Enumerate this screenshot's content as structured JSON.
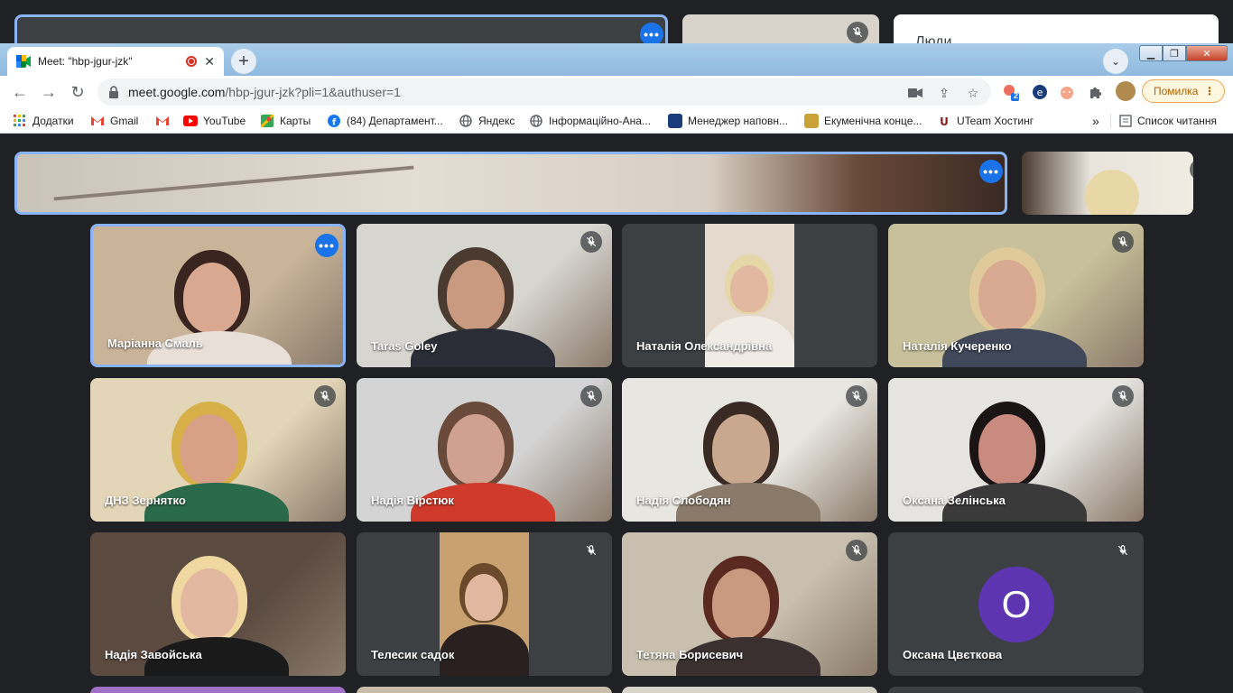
{
  "background_meet": {
    "people_panel_title": "Люди"
  },
  "browser": {
    "tab": {
      "title": "Meet: \"hbp-jgur-jzk\""
    },
    "new_tab_label": "+",
    "url": {
      "host": "meet.google.com",
      "path": "/hbp-jgur-jzk?pli=1&authuser=1"
    },
    "error_button_label": "Помилка",
    "extension_badge": "2",
    "bookmarks": [
      {
        "label": "Додатки",
        "icon": "apps-grid-icon",
        "color": "#ea4335"
      },
      {
        "label": "Gmail",
        "icon": "gmail-icon",
        "color": "#ea4335"
      },
      {
        "label": "",
        "icon": "gmail-icon",
        "color": "#ea4335"
      },
      {
        "label": "YouTube",
        "icon": "youtube-icon",
        "color": "#ff0000"
      },
      {
        "label": "Карты",
        "icon": "maps-icon",
        "color": "#34a853"
      },
      {
        "label": "(84) Департамент...",
        "icon": "facebook-icon",
        "color": "#1877f2"
      },
      {
        "label": "Яндекс",
        "icon": "globe-icon",
        "color": "#5f6368"
      },
      {
        "label": "Інформаційно-Ана...",
        "icon": "globe-icon",
        "color": "#5f6368"
      },
      {
        "label": "Менеджер наповн...",
        "icon": "site-icon",
        "color": "#1a3d7c"
      },
      {
        "label": "Екуменічна конце...",
        "icon": "site-icon",
        "color": "#c9a23a"
      },
      {
        "label": "UTeam Хостинг",
        "icon": "uteam-icon",
        "color": "#8b1a1a"
      }
    ],
    "bookmarks_more": "»",
    "reading_list": "Список читання"
  },
  "participants": [
    {
      "name": "Маріанна Смаль",
      "active": true,
      "muted": false,
      "bg": "#c9b49a",
      "face": "#d9a890",
      "hair": "#3a2420",
      "shirt": "#e8e0d8"
    },
    {
      "name": "Taras Goley",
      "active": false,
      "muted": true,
      "bg": "#d7d5d0",
      "face": "#c99a80",
      "hair": "#4a3a30",
      "shirt": "#2a2d36"
    },
    {
      "name": "Наталія Олександрівна",
      "active": false,
      "muted": false,
      "bg": "#e4d9cc",
      "face": "#e3b8a0",
      "hair": "#e6d7a8",
      "shirt": "#f0ebe4"
    },
    {
      "name": "Наталія Кучеренко",
      "active": false,
      "muted": true,
      "bg": "#c7c09a",
      "face": "#d9aa92",
      "hair": "#e0c99a",
      "shirt": "#40485a"
    },
    {
      "name": "ДНЗ Зернятко",
      "active": false,
      "muted": true,
      "bg": "#e3d6b8",
      "face": "#d9a088",
      "hair": "#d8b04a",
      "shirt": "#2a6a4a"
    },
    {
      "name": "Надія Вірстюк",
      "active": false,
      "muted": true,
      "bg": "#d4d4d4",
      "face": "#d0a090",
      "hair": "#6a4a3a",
      "shirt": "#d03a2a"
    },
    {
      "name": "Надія Слободян",
      "active": false,
      "muted": true,
      "bg": "#e8e6e0",
      "face": "#c9a890",
      "hair": "#3a2a24",
      "shirt": "#8a7a6a"
    },
    {
      "name": "Оксана Зелінська",
      "active": false,
      "muted": true,
      "bg": "#e6e4e0",
      "face": "#c98a80",
      "hair": "#1a1414",
      "shirt": "#3a3a3a"
    },
    {
      "name": "Надія Завойська",
      "active": false,
      "muted": false,
      "bg": "#5a4a40",
      "face": "#e3b8a0",
      "hair": "#f0d8a0",
      "shirt": "#1a1a1a"
    },
    {
      "name": "Телесик садок",
      "active": false,
      "muted": true,
      "bg": "#c9a070",
      "face": "#e3b8a0",
      "hair": "#6a4a2a",
      "shirt": "#2a2020"
    },
    {
      "name": "Тетяна Борисевич",
      "active": false,
      "muted": true,
      "bg": "#c8bfae",
      "face": "#c99a80",
      "hair": "#5a2a20",
      "shirt": "#3a3030"
    },
    {
      "name": "Оксана Цвєткова",
      "active": false,
      "muted": true,
      "avatar_letter": "O",
      "avatar_color": "#5e35b1"
    }
  ]
}
